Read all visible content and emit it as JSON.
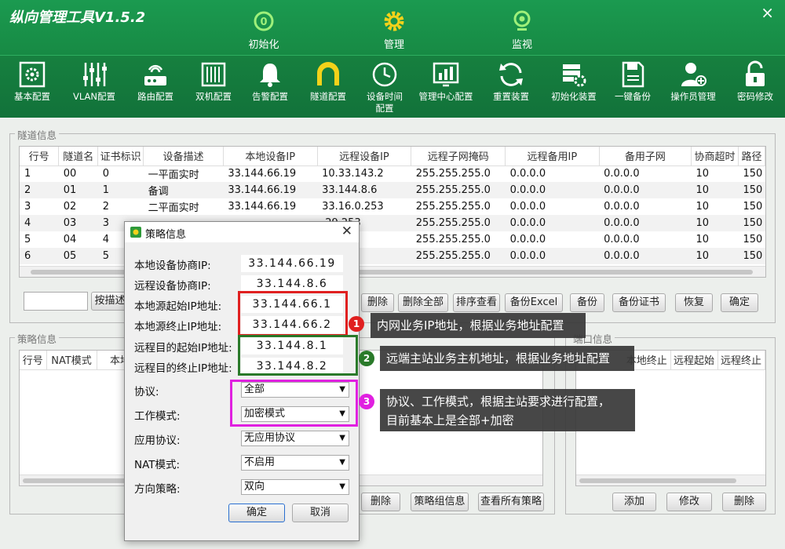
{
  "app": {
    "title": "纵向管理工具V1.5.2",
    "close": "×"
  },
  "mode_tabs": [
    {
      "label": "初始化",
      "icon": "init-icon"
    },
    {
      "label": "管理",
      "icon": "gear-icon"
    },
    {
      "label": "监视",
      "icon": "camera-icon"
    }
  ],
  "toolbar": [
    {
      "label": "基本配置",
      "icon": "settings-panel-icon"
    },
    {
      "label": "VLAN配置",
      "icon": "sliders-icon"
    },
    {
      "label": "路由配置",
      "icon": "router-icon"
    },
    {
      "label": "双机配置",
      "icon": "server-icon"
    },
    {
      "label": "告警配置",
      "icon": "bell-icon"
    },
    {
      "label": "隧道配置",
      "icon": "tunnel-icon"
    },
    {
      "label": "设备时间",
      "label2": "配置",
      "icon": "clock-icon"
    },
    {
      "label": "管理中心配置",
      "icon": "chart-icon"
    },
    {
      "label": "重置装置",
      "icon": "refresh-icon"
    },
    {
      "label": "初始化装置",
      "icon": "init-device-icon"
    },
    {
      "label": "一键备份",
      "icon": "backup-icon"
    },
    {
      "label": "操作员管理",
      "icon": "user-add-icon"
    },
    {
      "label": "密码修改",
      "icon": "lock-icon"
    }
  ],
  "tunnel": {
    "title": "隧道信息",
    "columns": [
      "行号",
      "隧道名",
      "证书标识",
      "设备描述",
      "本地设备IP",
      "远程设备IP",
      "远程子网掩码",
      "远程备用IP",
      "备用子网",
      "协商超时",
      "路径"
    ],
    "rows": [
      [
        "1",
        "00",
        "0",
        "一平面实时",
        "33.144.66.19",
        "10.33.143.2",
        "255.255.255.0",
        "0.0.0.0",
        "0.0.0.0",
        "10",
        "150"
      ],
      [
        "2",
        "01",
        "1",
        "备调",
        "33.144.66.19",
        "33.144.8.6",
        "255.255.255.0",
        "0.0.0.0",
        "0.0.0.0",
        "10",
        "150"
      ],
      [
        "3",
        "02",
        "2",
        "二平面实时",
        "33.144.66.19",
        "33.16.0.253",
        "255.255.255.0",
        "0.0.0.0",
        "0.0.0.0",
        "10",
        "150"
      ],
      [
        "4",
        "03",
        "3",
        "",
        "",
        ".29.253",
        "255.255.255.0",
        "0.0.0.0",
        "0.0.0.0",
        "10",
        "150"
      ],
      [
        "5",
        "04",
        "4",
        "",
        "",
        ".253",
        "255.255.255.0",
        "0.0.0.0",
        "0.0.0.0",
        "10",
        "150"
      ],
      [
        "6",
        "05",
        "5",
        "",
        "",
        "0.13",
        "255.255.255.0",
        "0.0.0.0",
        "0.0.0.0",
        "10",
        "150"
      ]
    ]
  },
  "tunnel_buttons": {
    "search_value": "",
    "search_by": "按描述",
    "delete": "删除",
    "delete_all": "删除全部",
    "sort_view": "排序查看",
    "backup_excel": "备份Excel",
    "backup": "备份",
    "backup_cert": "备份证书",
    "restore": "恢复",
    "ok": "确定"
  },
  "policy": {
    "title": "策略信息",
    "columns": [
      "行号",
      "NAT模式",
      "本地"
    ],
    "buttons": {
      "delete": "删除",
      "group_info": "策略组信息",
      "view_all": "查看所有策略"
    }
  },
  "port": {
    "title": "端口信息",
    "columns": [
      "本地终止",
      "远程起始",
      "远程终止"
    ],
    "buttons": {
      "add": "添加",
      "modify": "修改",
      "delete": "删除"
    }
  },
  "dialog": {
    "title": "策略信息",
    "close": "✕",
    "fields": [
      {
        "label": "本地设备协商IP:",
        "value": "33.144.66.19"
      },
      {
        "label": "远程设备协商IP:",
        "value": "33.144.8.6"
      },
      {
        "label": "本地源起始IP地址:",
        "value": "33.144.66.1"
      },
      {
        "label": "本地源终止IP地址:",
        "value": "33.144.66.2"
      },
      {
        "label": "远程目的起始IP地址:",
        "value": "33.144.8.1"
      },
      {
        "label": "远程目的终止IP地址:",
        "value": "33.144.8.2"
      }
    ],
    "combos": [
      {
        "label": "协议:",
        "value": "全部"
      },
      {
        "label": "工作模式:",
        "value": "加密模式"
      },
      {
        "label": "应用协议:",
        "value": "无应用协议"
      },
      {
        "label": "NAT模式:",
        "value": "不启用"
      },
      {
        "label": "方向策略:",
        "value": "双向"
      }
    ],
    "ok": "确定",
    "cancel": "取消"
  },
  "annotations": [
    {
      "num": "1",
      "text": "内网业务IP地址，根据业务地址配置",
      "color": "#e02020"
    },
    {
      "num": "2",
      "text": "远端主站业务主机地址，根据业务地址配置",
      "color": "#2a7a2a"
    },
    {
      "num": "3",
      "text": "协议、工作模式，根据主站要求进行配置，",
      "text2": "目前基本上是全部+加密",
      "color": "#e020e0"
    }
  ]
}
